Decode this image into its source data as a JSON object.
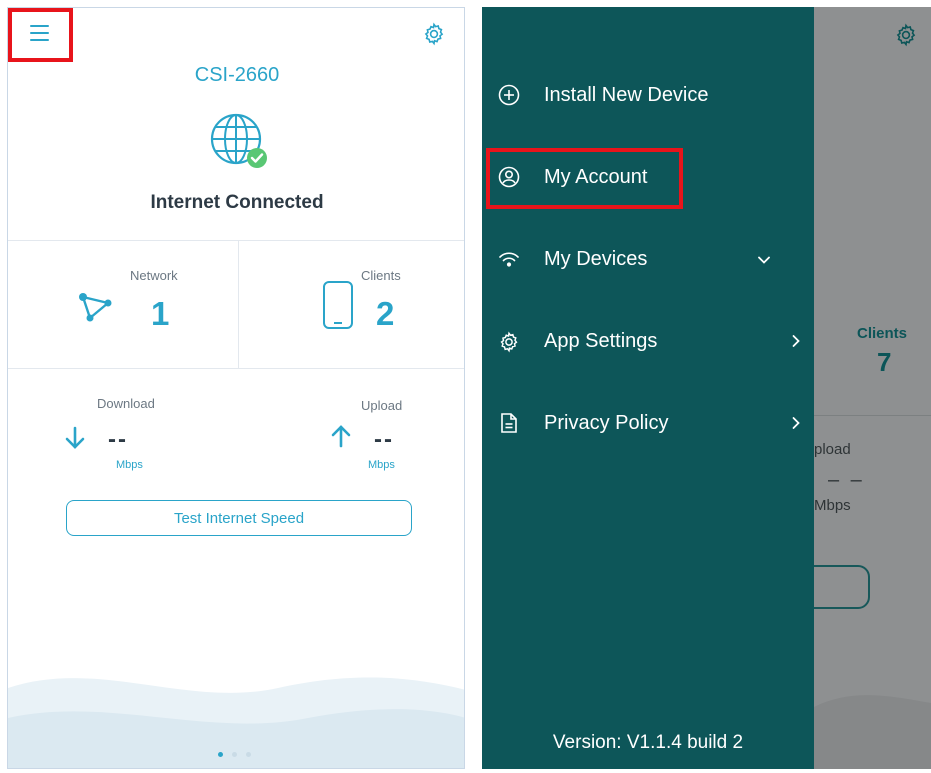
{
  "colors": {
    "accent": "#2aa4c9",
    "drawer_bg": "#0d5659",
    "highlight": "#e8141b",
    "text_dark": "#2d3a45"
  },
  "home": {
    "menu_icon": "hamburger-menu-icon",
    "settings_icon": "gear-icon",
    "device_name": "CSI-2660",
    "status": "Internet Connected",
    "network": {
      "label": "Network",
      "value": "1"
    },
    "clients": {
      "label": "Clients",
      "value": "2"
    },
    "download": {
      "label": "Download",
      "value": "--",
      "unit": "Mbps"
    },
    "upload": {
      "label": "Upload",
      "value": "--",
      "unit": "Mbps"
    },
    "test_button": "Test Internet Speed",
    "pager": {
      "pages": 3,
      "current": 1
    }
  },
  "drawer": {
    "items": [
      {
        "label": "Install New Device",
        "icon": "plus-circle-icon"
      },
      {
        "label": "My Account",
        "icon": "user-circle-icon"
      },
      {
        "label": "My Devices",
        "icon": "wifi-icon",
        "chevron": "chevron-down-icon"
      },
      {
        "label": "App Settings",
        "icon": "gear-icon",
        "chevron": "chevron-right-icon"
      },
      {
        "label": "Privacy Policy",
        "icon": "document-icon",
        "chevron": "chevron-right-icon"
      }
    ],
    "version": "Version: V1.1.4 build 2"
  },
  "background": {
    "clients_label": "Clients",
    "clients_value": "7",
    "upload_label": "pload",
    "upload_value": "– –",
    "unit": "Mbps"
  }
}
